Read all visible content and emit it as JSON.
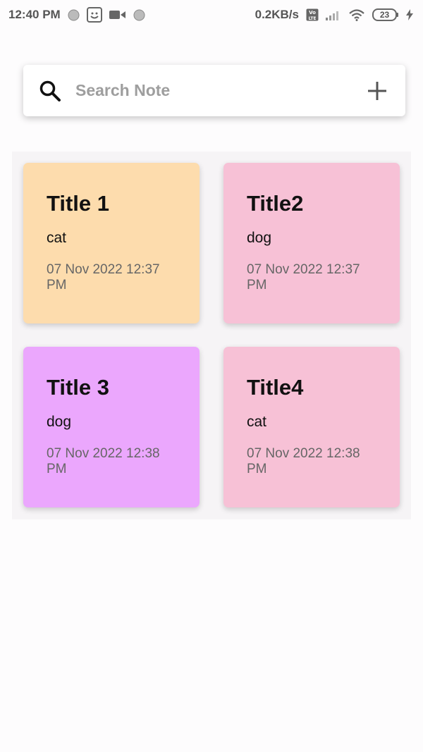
{
  "status_bar": {
    "time": "12:40 PM",
    "net_speed": "0.2KB/s",
    "battery": "23",
    "icons": [
      "notification-dot-icon",
      "face-app-icon",
      "video-camera-icon",
      "notification-dot-icon",
      "volte-icon",
      "signal-icon",
      "wifi-icon",
      "battery-icon",
      "charging-icon"
    ]
  },
  "search": {
    "placeholder": "Search Note",
    "value": ""
  },
  "notes": [
    {
      "title": "Title 1",
      "body": "cat",
      "date": "07 Nov 2022 12:37 PM",
      "color": "#fddcad"
    },
    {
      "title": "Title2",
      "body": "dog",
      "date": "07 Nov 2022 12:37 PM",
      "color": "#f7c1d6"
    },
    {
      "title": "Title 3",
      "body": "dog",
      "date": "07 Nov 2022 12:38 PM",
      "color": "#eba7fd"
    },
    {
      "title": "Title4",
      "body": "cat",
      "date": "07 Nov 2022 12:38 PM",
      "color": "#f7c1d6"
    }
  ],
  "colors": {
    "background": "#fdfcfd",
    "search_card": "#ffffff",
    "placeholder": "#9e9e9e",
    "date_text": "#666666"
  }
}
